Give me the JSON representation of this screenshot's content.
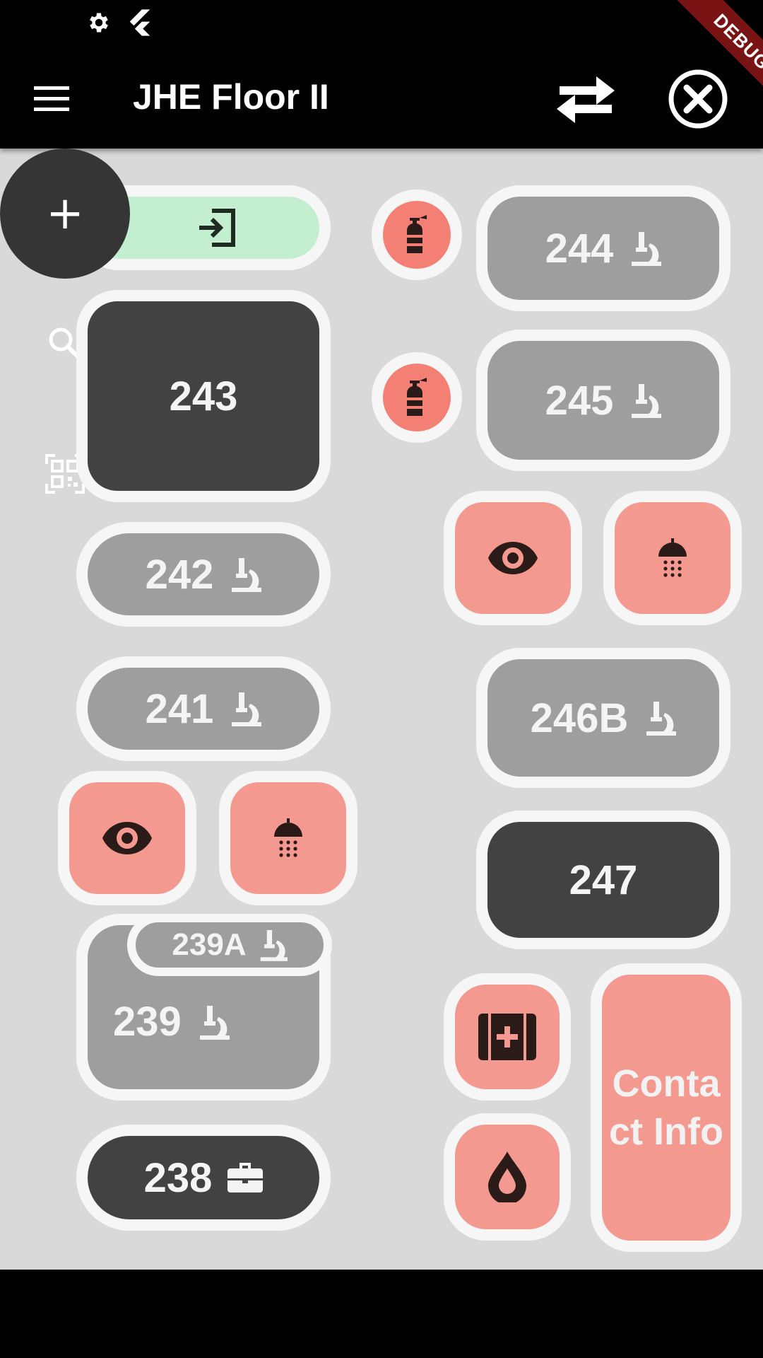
{
  "status_bar": {
    "icons": [
      "gear-icon",
      "flutter-logo-icon"
    ]
  },
  "app_bar": {
    "title": "JHE Floor II",
    "icons": [
      "menu-icon",
      "swap-icon",
      "close-circle-icon"
    ],
    "debug_label": "DEBUG",
    "debug_color": "#7a1414"
  },
  "fab": {
    "label": "+"
  },
  "side_tools": [
    "search-icon",
    "qr-code-icon"
  ],
  "colors": {
    "background": "#d9d9d9",
    "room_gray": "#9e9e9e",
    "room_dark": "#424242",
    "amenity_pink": "#f4998f",
    "extinguisher_red": "#f47f74",
    "entrance_green": "#c3efd0",
    "tile_border": "#f6f6f6"
  },
  "rooms": {
    "r243": {
      "number": "243"
    },
    "r244": {
      "number": "244",
      "icon": "microscope-icon"
    },
    "r245": {
      "number": "245",
      "icon": "microscope-icon"
    },
    "r242": {
      "number": "242",
      "icon": "microscope-icon"
    },
    "r241": {
      "number": "241",
      "icon": "microscope-icon"
    },
    "r246b": {
      "number": "246B",
      "icon": "microscope-icon"
    },
    "r247": {
      "number": "247"
    },
    "r239": {
      "number": "239",
      "icon": "microscope-icon"
    },
    "r239a": {
      "number": "239A",
      "icon": "microscope-icon"
    },
    "r238": {
      "number": "238",
      "icon": "briefcase-icon"
    }
  },
  "amenities": {
    "entrance": "entrance-icon",
    "fire_extinguisher": "fire-extinguisher-icon",
    "eyewash": "eye-icon",
    "shower": "shower-icon",
    "first_aid": "first-aid-icon",
    "water": "water-drop-icon"
  },
  "contact": {
    "label": "Contact Info"
  }
}
